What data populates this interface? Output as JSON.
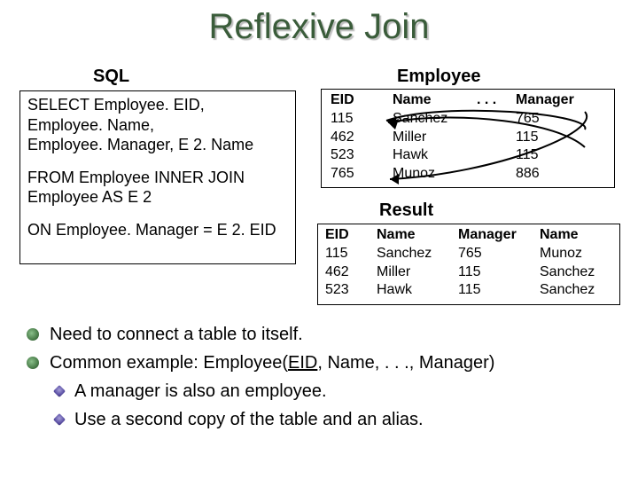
{
  "title": "Reflexive Join",
  "sql": {
    "heading": "SQL",
    "select1": "SELECT Employee. EID,",
    "select2": "Employee. Name,",
    "select3": "Employee. Manager, E 2. Name",
    "from1": "FROM Employee INNER JOIN",
    "from2": "Employee AS E 2",
    "on": "ON Employee. Manager = E 2. EID"
  },
  "employee": {
    "heading": "Employee",
    "headers": [
      "EID",
      "Name",
      ". . .",
      "Manager"
    ],
    "rows": [
      [
        "115",
        "Sanchez",
        "765"
      ],
      [
        "462",
        "Miller",
        "115"
      ],
      [
        "523",
        "Hawk",
        "115"
      ],
      [
        "765",
        "Munoz",
        "886"
      ]
    ]
  },
  "result": {
    "heading": "Result",
    "headers": [
      "EID",
      "Name",
      "Manager",
      "Name"
    ],
    "rows": [
      [
        "115",
        "Sanchez",
        "765",
        "Munoz"
      ],
      [
        "462",
        "Miller",
        "115",
        "Sanchez"
      ],
      [
        "523",
        "Hawk",
        "115",
        "Sanchez"
      ]
    ]
  },
  "bullets": {
    "0": "Need to connect a table to itself.",
    "1a": "Common example:  Employee(",
    "1u": "EID",
    "1b": ", Name, . . ., Manager)",
    "2": "A manager is also an employee.",
    "3": "Use a second copy of the table and an alias."
  }
}
